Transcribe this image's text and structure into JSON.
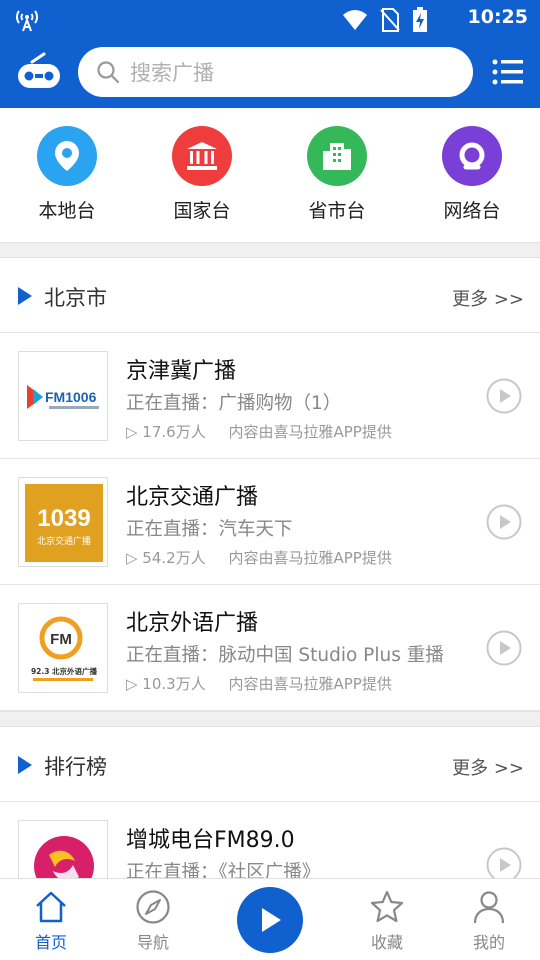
{
  "status_bar": {
    "time": "10:25"
  },
  "header": {
    "search_placeholder": "搜索广播"
  },
  "categories": [
    {
      "label": "本地台",
      "color": "#2aa4f0",
      "icon": "location-pin-icon"
    },
    {
      "label": "国家台",
      "color": "#ef3c3c",
      "icon": "government-building-icon"
    },
    {
      "label": "省市台",
      "color": "#35b85a",
      "icon": "city-building-icon"
    },
    {
      "label": "网络台",
      "color": "#7a3fd6",
      "icon": "network-q-icon"
    }
  ],
  "sections": [
    {
      "title": "北京市",
      "more": "更多 >>",
      "items": [
        {
          "name": "京津冀广播",
          "live": "正在直播：广播购物（1）",
          "listeners": "▷ 17.6万人",
          "source": "内容由喜马拉雅APP提供",
          "logo_text": "FM1006"
        },
        {
          "name": "北京交通广播",
          "live": "正在直播：汽车天下",
          "listeners": "▷ 54.2万人",
          "source": "内容由喜马拉雅APP提供",
          "logo_text": "1039",
          "logo_sub": "北京交通广播"
        },
        {
          "name": "北京外语广播",
          "live": "正在直播：脉动中国 Studio Plus 重播",
          "listeners": "▷ 10.3万人",
          "source": "内容由喜马拉雅APP提供",
          "logo_text": "FM",
          "logo_sub": "92.3 北京外语广播"
        }
      ]
    },
    {
      "title": "排行榜",
      "more": "更多 >>",
      "items": [
        {
          "name": "增城电台FM89.0",
          "live": "正在直播：《社区广播》"
        }
      ]
    }
  ],
  "bottom_nav": [
    {
      "label": "首页",
      "icon": "home-icon",
      "active": true
    },
    {
      "label": "导航",
      "icon": "compass-icon",
      "active": false
    },
    {
      "label": "收藏",
      "icon": "star-icon",
      "active": false
    },
    {
      "label": "我的",
      "icon": "person-icon",
      "active": false
    }
  ],
  "colors": {
    "brand": "#1060d0",
    "background_gap": "#f0f0f0"
  }
}
